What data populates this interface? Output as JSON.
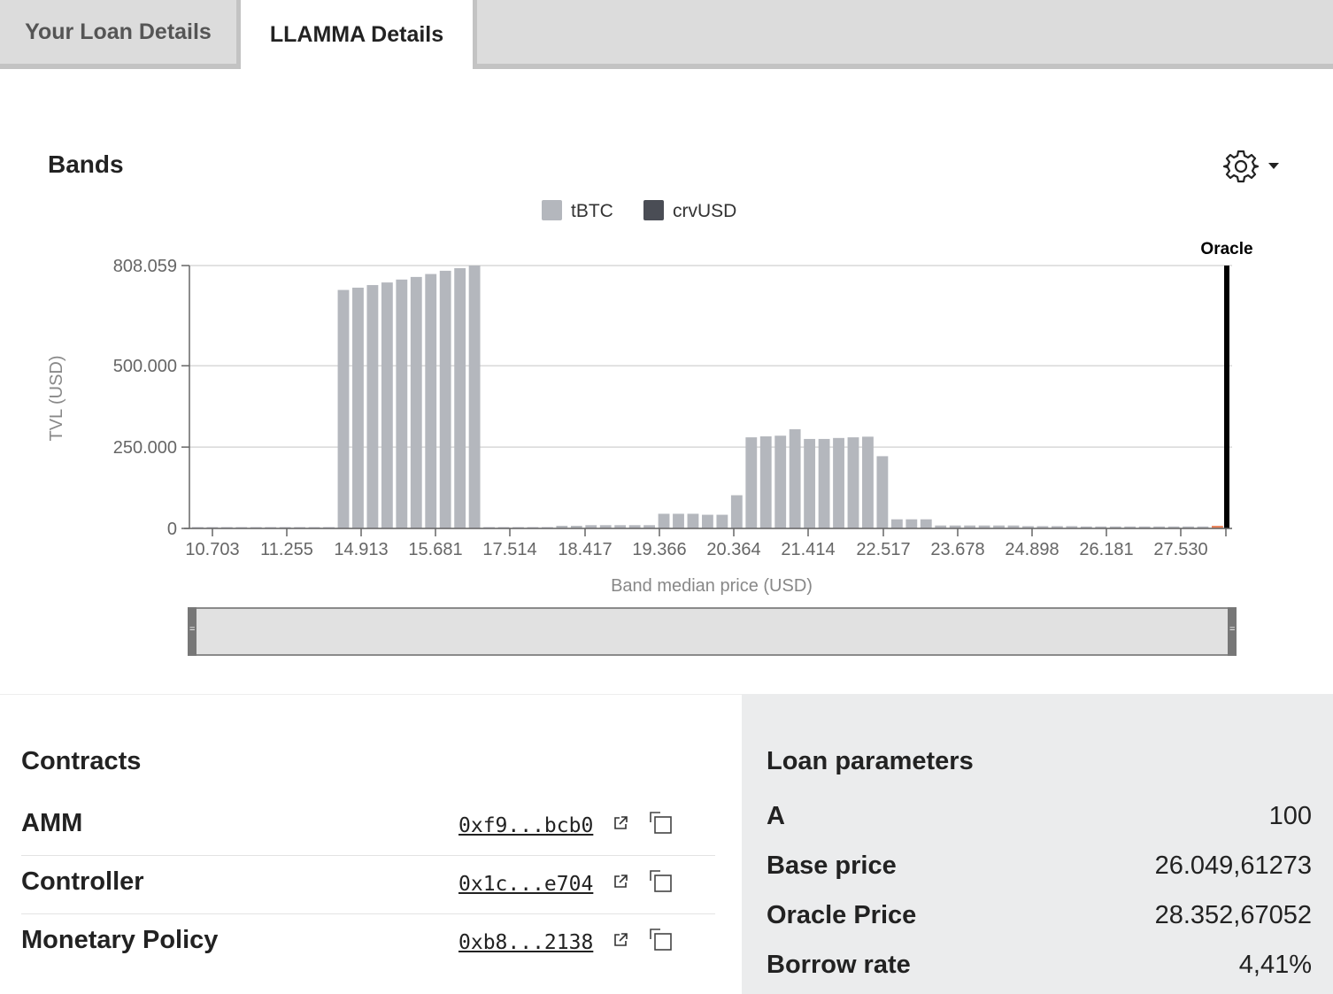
{
  "tabs": [
    {
      "label": "Your Loan Details",
      "active": false
    },
    {
      "label": "LLAMMA Details",
      "active": true
    }
  ],
  "bands": {
    "title": "Bands",
    "settings_icon": "gear-icon",
    "dropdown_icon": "caret-down-icon"
  },
  "chart_data": {
    "type": "bar",
    "ylabel": "TVL (USD)",
    "xlabel": "Band median price (USD)",
    "legend": [
      "tBTC",
      "crvUSD"
    ],
    "legend_position": "top-center",
    "grid": true,
    "colors": {
      "tBTC": "#b4b7bd",
      "crvUSD": "#4a4d55",
      "oracle": "#000000",
      "highlight": "#e8825a"
    },
    "y_ticks": [
      0,
      250000,
      500000,
      808059
    ],
    "y_tick_labels": [
      "0",
      "250.000",
      "500.000",
      "808.059"
    ],
    "ylim": [
      0,
      808059
    ],
    "x_tick_labels": [
      "10.703",
      "11.255",
      "14.913",
      "15.681",
      "17.514",
      "18.417",
      "19.366",
      "20.364",
      "21.414",
      "22.517",
      "23.678",
      "24.898",
      "26.181",
      "27.530"
    ],
    "oracle_label": "Oracle",
    "oracle_price": 28352.67,
    "series": [
      {
        "name": "tBTC",
        "values": [
          4000,
          4000,
          4000,
          4000,
          4000,
          4000,
          4000,
          4000,
          4000,
          4000,
          733000,
          740000,
          748000,
          756000,
          765000,
          773000,
          782000,
          792000,
          800000,
          808059,
          4000,
          4000,
          4000,
          4000,
          4000,
          8000,
          8000,
          10000,
          10000,
          10000,
          10000,
          10000,
          45000,
          45000,
          45000,
          42000,
          42000,
          102000,
          280000,
          283000,
          285000,
          305000,
          275000,
          275000,
          278000,
          280000,
          282000,
          222000,
          28000,
          28000,
          28000,
          9000,
          9000,
          9000,
          9000,
          9000,
          9000,
          7000,
          7000,
          7000,
          7000,
          6000,
          6000,
          6000,
          6000,
          6000,
          6000,
          6000,
          6000,
          6000
        ],
        "last_band_highlight_value": 8000
      },
      {
        "name": "crvUSD",
        "values": []
      }
    ]
  },
  "contracts": {
    "title": "Contracts",
    "rows": [
      {
        "label": "AMM",
        "address": "0xf9...bcb0"
      },
      {
        "label": "Controller",
        "address": "0x1c...e704"
      },
      {
        "label": "Monetary Policy",
        "address": "0xb8...2138"
      }
    ]
  },
  "loan_parameters": {
    "title": "Loan parameters",
    "rows": [
      {
        "label": "A",
        "value": "100"
      },
      {
        "label": "Base price",
        "value": "26.049,61273"
      },
      {
        "label": "Oracle Price",
        "value": "28.352,67052"
      },
      {
        "label": "Borrow rate",
        "value": "4,41%"
      }
    ]
  }
}
